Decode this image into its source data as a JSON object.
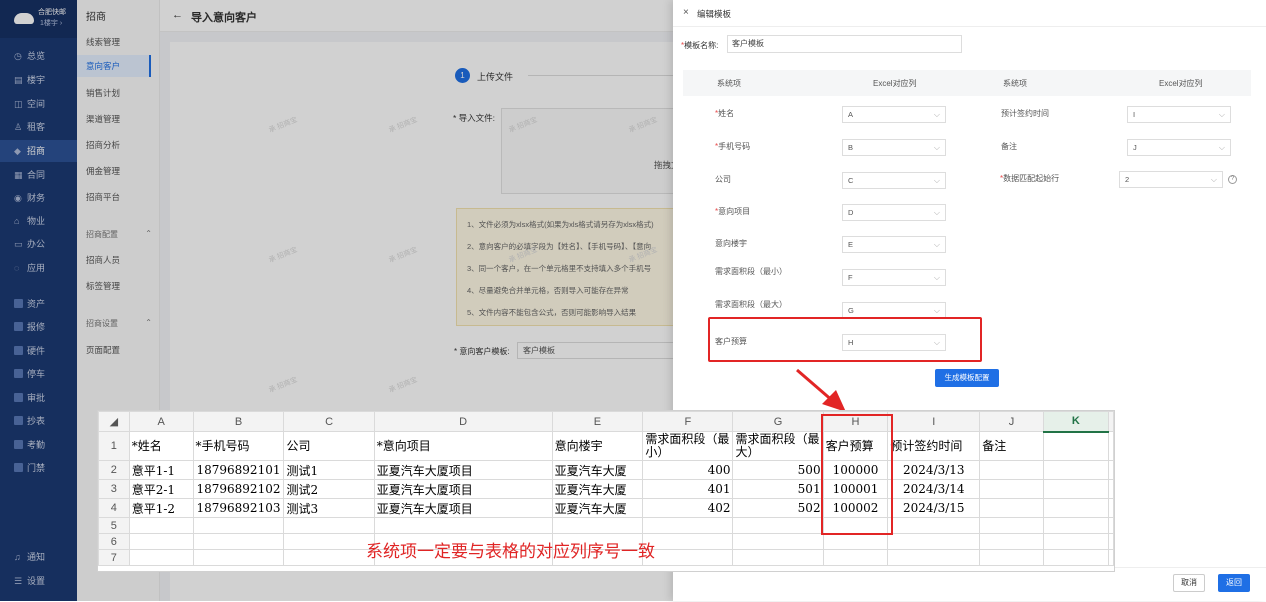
{
  "brand": {
    "name": "合肥快邮",
    "sub": "1楼宇 ›"
  },
  "sidebar": {
    "items": [
      {
        "label": "总览",
        "icon": "◷"
      },
      {
        "label": "楼宇",
        "icon": "▤"
      },
      {
        "label": "空间",
        "icon": "◫"
      },
      {
        "label": "租客",
        "icon": "♙"
      },
      {
        "label": "招商",
        "icon": "◆",
        "active": true
      },
      {
        "label": "合同",
        "icon": "▦"
      },
      {
        "label": "财务",
        "icon": "◉"
      },
      {
        "label": "物业",
        "icon": "⌂"
      },
      {
        "label": "办公",
        "icon": "▭"
      },
      {
        "label": "应用",
        "icon": "◌"
      }
    ],
    "apps": [
      "资产",
      "报修",
      "硬件",
      "停车",
      "审批",
      "抄表",
      "考勤",
      "门禁"
    ],
    "bottom": [
      {
        "label": "通知",
        "icon": "♫"
      },
      {
        "label": "设置",
        "icon": "☰"
      }
    ]
  },
  "subnav": {
    "title": "招商",
    "items": [
      "线索管理",
      "意向客户",
      "销售计划",
      "渠道管理",
      "招商分析",
      "佣金管理",
      "招商平台"
    ],
    "group1": "招商配置",
    "group1_items": [
      "招商人员",
      "标签管理"
    ],
    "group2": "招商设置",
    "group2_items": [
      "页面配置"
    ]
  },
  "page": {
    "back": "←",
    "title": "导入意向客户",
    "step_num": "1",
    "step_label": "上传文件",
    "import_label": "* 导入文件:",
    "drop_text": "拖拽文",
    "tips": [
      "1、文件必须为xlsx格式(如果为xls格式请另存为xlsx格式)",
      "2、意向客户的必填字段为【姓名】、【手机号码】、【意向",
      "3、同一个客户，在一个单元格里不支持填入多个手机号",
      "4、尽量避免合并单元格，否则导入可能存在异常",
      "5、文件内容不能包含公式，否则可能影响导入结果"
    ],
    "tmpl_label": "* 意向客户模板:",
    "tmpl_value": "客户模板",
    "watermark": "承 招商宝"
  },
  "drawer": {
    "close": "×",
    "title": "编辑模板",
    "name_label": "模板名称:",
    "name_value": "客户模板",
    "headers": [
      "系统项",
      "Excel对应列",
      "系统项",
      "Excel对应列"
    ],
    "left": [
      {
        "label": "姓名",
        "req": true,
        "value": "A"
      },
      {
        "label": "手机号码",
        "req": true,
        "value": "B"
      },
      {
        "label": "公司",
        "req": false,
        "value": "C"
      },
      {
        "label": "意向项目",
        "req": true,
        "value": "D"
      },
      {
        "label": "意向楼宇",
        "req": false,
        "value": "E"
      },
      {
        "label": "需求面积段（最小）",
        "req": false,
        "value": "F"
      },
      {
        "label": "需求面积段（最大）",
        "req": false,
        "value": "G"
      },
      {
        "label": "客户预算",
        "req": false,
        "value": "H"
      }
    ],
    "right": [
      {
        "label": "预计签约时间",
        "req": false,
        "value": "I"
      },
      {
        "label": "备注",
        "req": false,
        "value": "J"
      },
      {
        "label": "数据匹配起始行",
        "req": true,
        "value": "2"
      }
    ],
    "gen_button": "生成模板配置",
    "cancel": "取消",
    "ok": "返回",
    "help": "?"
  },
  "excel": {
    "columns": [
      "A",
      "B",
      "C",
      "D",
      "E",
      "F",
      "G",
      "H",
      "I",
      "J",
      "K"
    ],
    "corner": "◢",
    "header": [
      "*姓名",
      "*手机号码",
      "公司",
      "*意向项目",
      "意向楼宇",
      "需求面积段（最小）",
      "需求面积段（最大）",
      "客户预算",
      "预计签约时间",
      "备注",
      ""
    ],
    "rows": [
      [
        "意平1-1",
        "18796892101",
        "测试1",
        "亚夏汽车大厦项目",
        "亚夏汽车大厦",
        "400",
        "500",
        "100000",
        "2024/3/13",
        "",
        ""
      ],
      [
        "意平2-1",
        "18796892102",
        "测试2",
        "亚夏汽车大厦项目",
        "亚夏汽车大厦",
        "401",
        "501",
        "100001",
        "2024/3/14",
        "",
        ""
      ],
      [
        "意平1-2",
        "18796892103",
        "测试3",
        "亚夏汽车大厦项目",
        "亚夏汽车大厦",
        "402",
        "502",
        "100002",
        "2024/3/15",
        "",
        ""
      ]
    ],
    "empty_rows": [
      "5",
      "6",
      "7"
    ],
    "note": "系统项一定要与表格的对应列序号一致"
  },
  "colors": {
    "sidebar": "#1c3a73",
    "accent": "#1f6fe5",
    "highlight": "#e22525",
    "excel_green": "#217346"
  }
}
